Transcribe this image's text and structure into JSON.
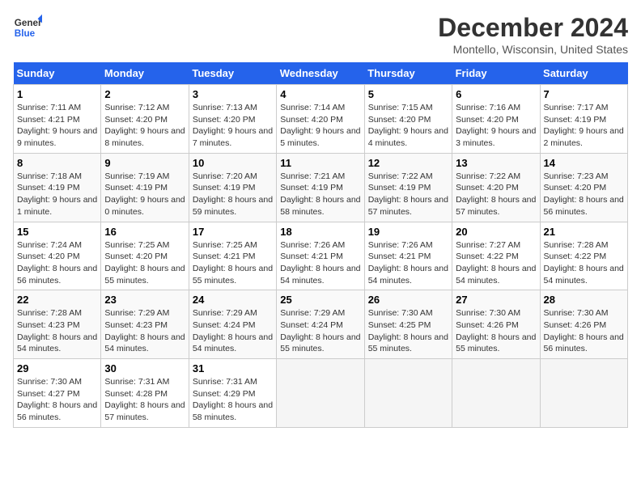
{
  "logo": {
    "line1": "General",
    "line2": "Blue"
  },
  "title": "December 2024",
  "subtitle": "Montello, Wisconsin, United States",
  "days_header": [
    "Sunday",
    "Monday",
    "Tuesday",
    "Wednesday",
    "Thursday",
    "Friday",
    "Saturday"
  ],
  "weeks": [
    [
      {
        "day": 1,
        "sunrise": "7:11 AM",
        "sunset": "4:21 PM",
        "daylight": "9 hours and 9 minutes."
      },
      {
        "day": 2,
        "sunrise": "7:12 AM",
        "sunset": "4:20 PM",
        "daylight": "9 hours and 8 minutes."
      },
      {
        "day": 3,
        "sunrise": "7:13 AM",
        "sunset": "4:20 PM",
        "daylight": "9 hours and 7 minutes."
      },
      {
        "day": 4,
        "sunrise": "7:14 AM",
        "sunset": "4:20 PM",
        "daylight": "9 hours and 5 minutes."
      },
      {
        "day": 5,
        "sunrise": "7:15 AM",
        "sunset": "4:20 PM",
        "daylight": "9 hours and 4 minutes."
      },
      {
        "day": 6,
        "sunrise": "7:16 AM",
        "sunset": "4:20 PM",
        "daylight": "9 hours and 3 minutes."
      },
      {
        "day": 7,
        "sunrise": "7:17 AM",
        "sunset": "4:19 PM",
        "daylight": "9 hours and 2 minutes."
      }
    ],
    [
      {
        "day": 8,
        "sunrise": "7:18 AM",
        "sunset": "4:19 PM",
        "daylight": "9 hours and 1 minute."
      },
      {
        "day": 9,
        "sunrise": "7:19 AM",
        "sunset": "4:19 PM",
        "daylight": "9 hours and 0 minutes."
      },
      {
        "day": 10,
        "sunrise": "7:20 AM",
        "sunset": "4:19 PM",
        "daylight": "8 hours and 59 minutes."
      },
      {
        "day": 11,
        "sunrise": "7:21 AM",
        "sunset": "4:19 PM",
        "daylight": "8 hours and 58 minutes."
      },
      {
        "day": 12,
        "sunrise": "7:22 AM",
        "sunset": "4:19 PM",
        "daylight": "8 hours and 57 minutes."
      },
      {
        "day": 13,
        "sunrise": "7:22 AM",
        "sunset": "4:20 PM",
        "daylight": "8 hours and 57 minutes."
      },
      {
        "day": 14,
        "sunrise": "7:23 AM",
        "sunset": "4:20 PM",
        "daylight": "8 hours and 56 minutes."
      }
    ],
    [
      {
        "day": 15,
        "sunrise": "7:24 AM",
        "sunset": "4:20 PM",
        "daylight": "8 hours and 56 minutes."
      },
      {
        "day": 16,
        "sunrise": "7:25 AM",
        "sunset": "4:20 PM",
        "daylight": "8 hours and 55 minutes."
      },
      {
        "day": 17,
        "sunrise": "7:25 AM",
        "sunset": "4:21 PM",
        "daylight": "8 hours and 55 minutes."
      },
      {
        "day": 18,
        "sunrise": "7:26 AM",
        "sunset": "4:21 PM",
        "daylight": "8 hours and 54 minutes."
      },
      {
        "day": 19,
        "sunrise": "7:26 AM",
        "sunset": "4:21 PM",
        "daylight": "8 hours and 54 minutes."
      },
      {
        "day": 20,
        "sunrise": "7:27 AM",
        "sunset": "4:22 PM",
        "daylight": "8 hours and 54 minutes."
      },
      {
        "day": 21,
        "sunrise": "7:28 AM",
        "sunset": "4:22 PM",
        "daylight": "8 hours and 54 minutes."
      }
    ],
    [
      {
        "day": 22,
        "sunrise": "7:28 AM",
        "sunset": "4:23 PM",
        "daylight": "8 hours and 54 minutes."
      },
      {
        "day": 23,
        "sunrise": "7:29 AM",
        "sunset": "4:23 PM",
        "daylight": "8 hours and 54 minutes."
      },
      {
        "day": 24,
        "sunrise": "7:29 AM",
        "sunset": "4:24 PM",
        "daylight": "8 hours and 54 minutes."
      },
      {
        "day": 25,
        "sunrise": "7:29 AM",
        "sunset": "4:24 PM",
        "daylight": "8 hours and 55 minutes."
      },
      {
        "day": 26,
        "sunrise": "7:30 AM",
        "sunset": "4:25 PM",
        "daylight": "8 hours and 55 minutes."
      },
      {
        "day": 27,
        "sunrise": "7:30 AM",
        "sunset": "4:26 PM",
        "daylight": "8 hours and 55 minutes."
      },
      {
        "day": 28,
        "sunrise": "7:30 AM",
        "sunset": "4:26 PM",
        "daylight": "8 hours and 56 minutes."
      }
    ],
    [
      {
        "day": 29,
        "sunrise": "7:30 AM",
        "sunset": "4:27 PM",
        "daylight": "8 hours and 56 minutes."
      },
      {
        "day": 30,
        "sunrise": "7:31 AM",
        "sunset": "4:28 PM",
        "daylight": "8 hours and 57 minutes."
      },
      {
        "day": 31,
        "sunrise": "7:31 AM",
        "sunset": "4:29 PM",
        "daylight": "8 hours and 58 minutes."
      },
      null,
      null,
      null,
      null
    ]
  ]
}
